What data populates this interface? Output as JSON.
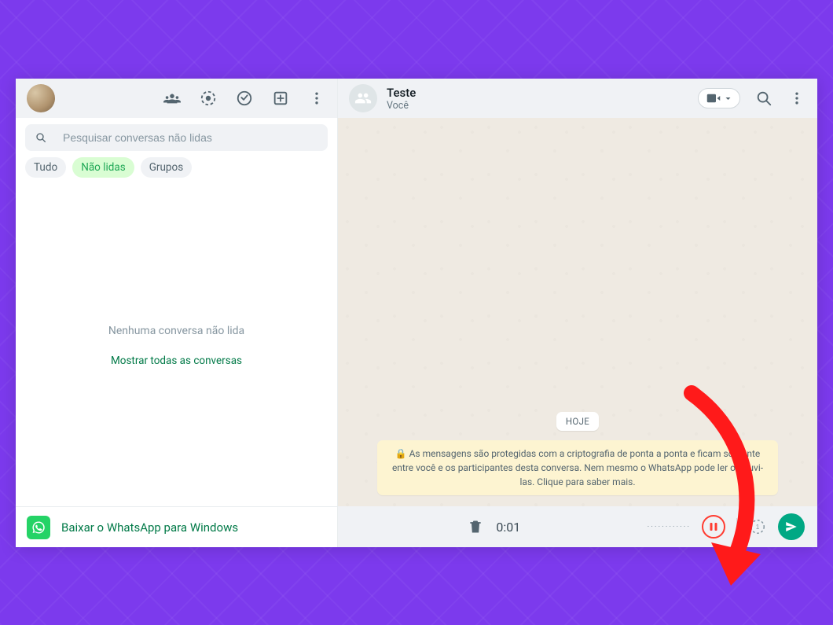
{
  "sidebar": {
    "search_placeholder": "Pesquisar conversas não lidas",
    "filters": {
      "all": "Tudo",
      "unread": "Não lidas",
      "groups": "Grupos"
    },
    "empty_state": "Nenhuma conversa não lida",
    "show_all": "Mostrar todas as conversas",
    "download_cta": "Baixar o WhatsApp para Windows"
  },
  "chat": {
    "title": "Teste",
    "subtitle": "Você",
    "date_badge": "HOJE",
    "enc_notice": "🔒 As mensagens são protegidas com a criptografia de ponta a ponta e ficam somente entre você e os participantes desta conversa. Nem mesmo o WhatsApp pode ler ou ouvi-las. Clique para saber mais."
  },
  "recording": {
    "time": "0:01",
    "waveform": "············"
  }
}
